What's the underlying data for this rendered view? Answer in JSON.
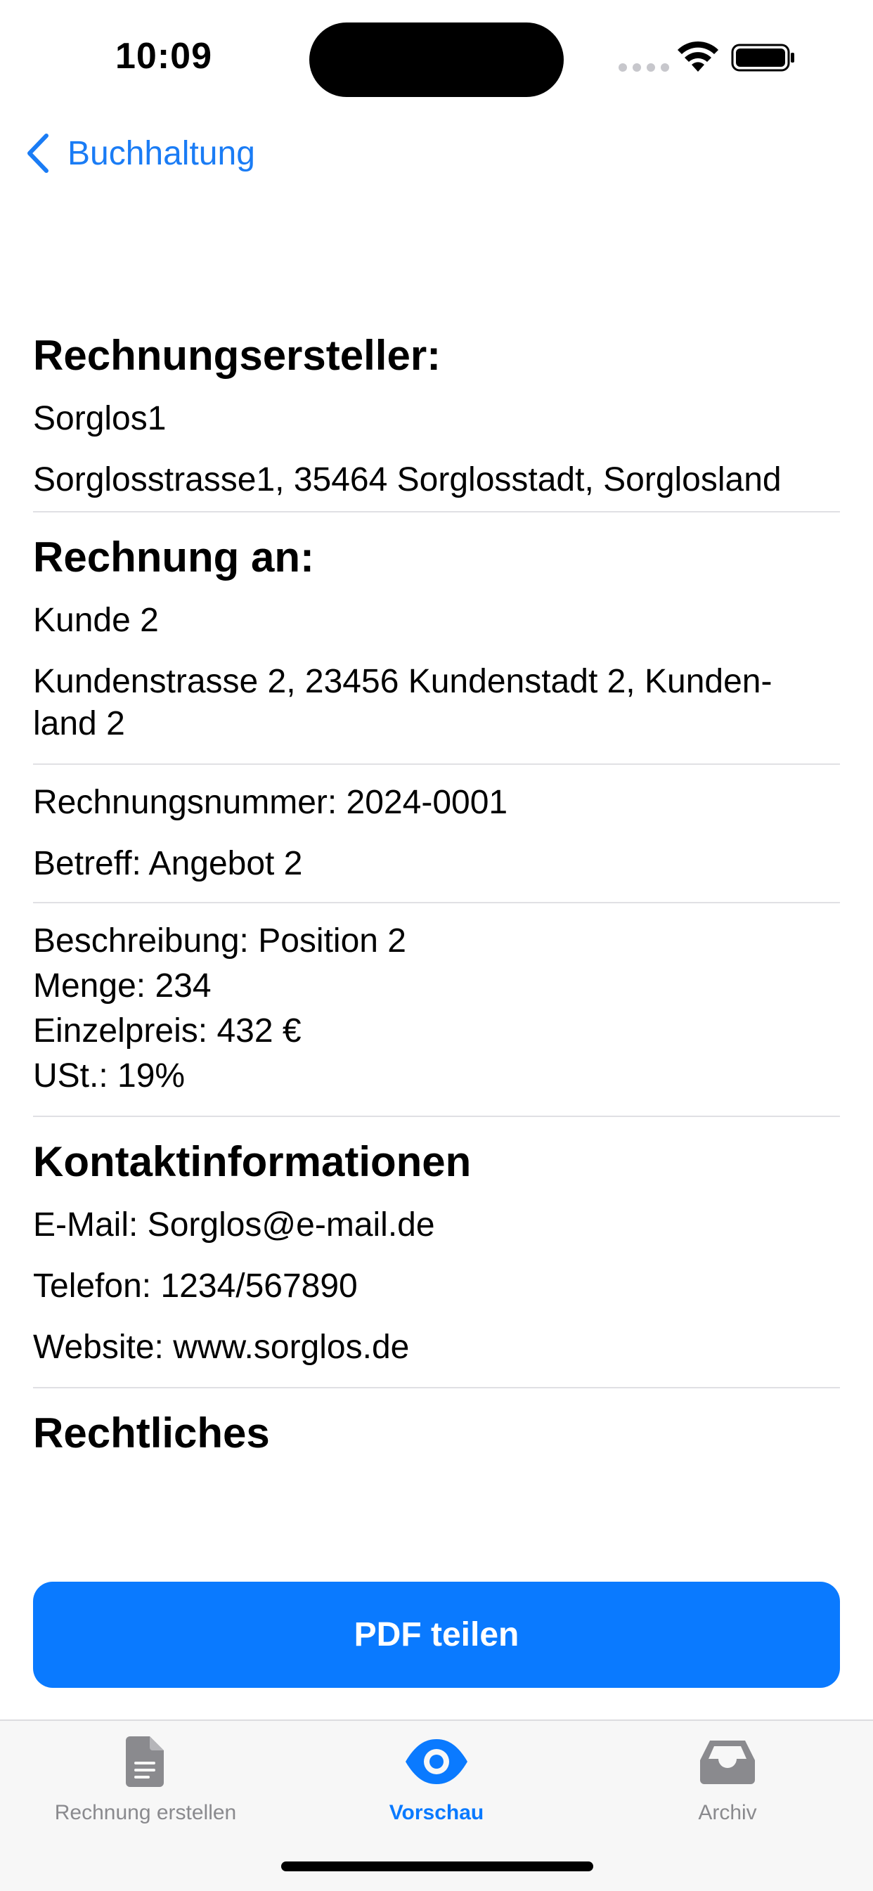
{
  "status_bar": {
    "time": "10:09"
  },
  "nav": {
    "back_label": "Buchhaltung"
  },
  "invoice": {
    "issuer": {
      "heading": "Rechnungsersteller:",
      "name": "Sorglos1",
      "address": "Sorglosstrasse1, 35464 Sorglosstadt, Sorglosland"
    },
    "recipient": {
      "heading": "Rechnung an:",
      "name": "Kunde 2",
      "address_line1": "Kundenstrasse 2, 23456 Kundenstadt 2, Kunden-",
      "address_line2": "land 2"
    },
    "meta": {
      "number": "Rechnungsnummer: 2024-0001",
      "subject": "Betreff: Angebot 2"
    },
    "position": {
      "description": "Beschreibung: Position 2",
      "quantity": "Menge: 234",
      "unit_price": "Einzelpreis: 432 €",
      "vat": "USt.: 19%"
    },
    "contact": {
      "heading": "Kontaktinformationen",
      "email": "E-Mail: Sorglos@e-mail.de",
      "phone": "Telefon: 1234/567890",
      "website": "Website: www.sorglos.de"
    },
    "legal": {
      "heading": "Rechtliches"
    }
  },
  "actions": {
    "share_label": "PDF teilen"
  },
  "tabs": [
    {
      "label": "Rechnung erstellen",
      "icon": "document-icon",
      "active": false
    },
    {
      "label": "Vorschau",
      "icon": "eye-icon",
      "active": true
    },
    {
      "label": "Archiv",
      "icon": "archive-tray-icon",
      "active": false
    }
  ],
  "colors": {
    "accent": "#0a7aff",
    "inactive_tab": "#8a8a8e"
  }
}
